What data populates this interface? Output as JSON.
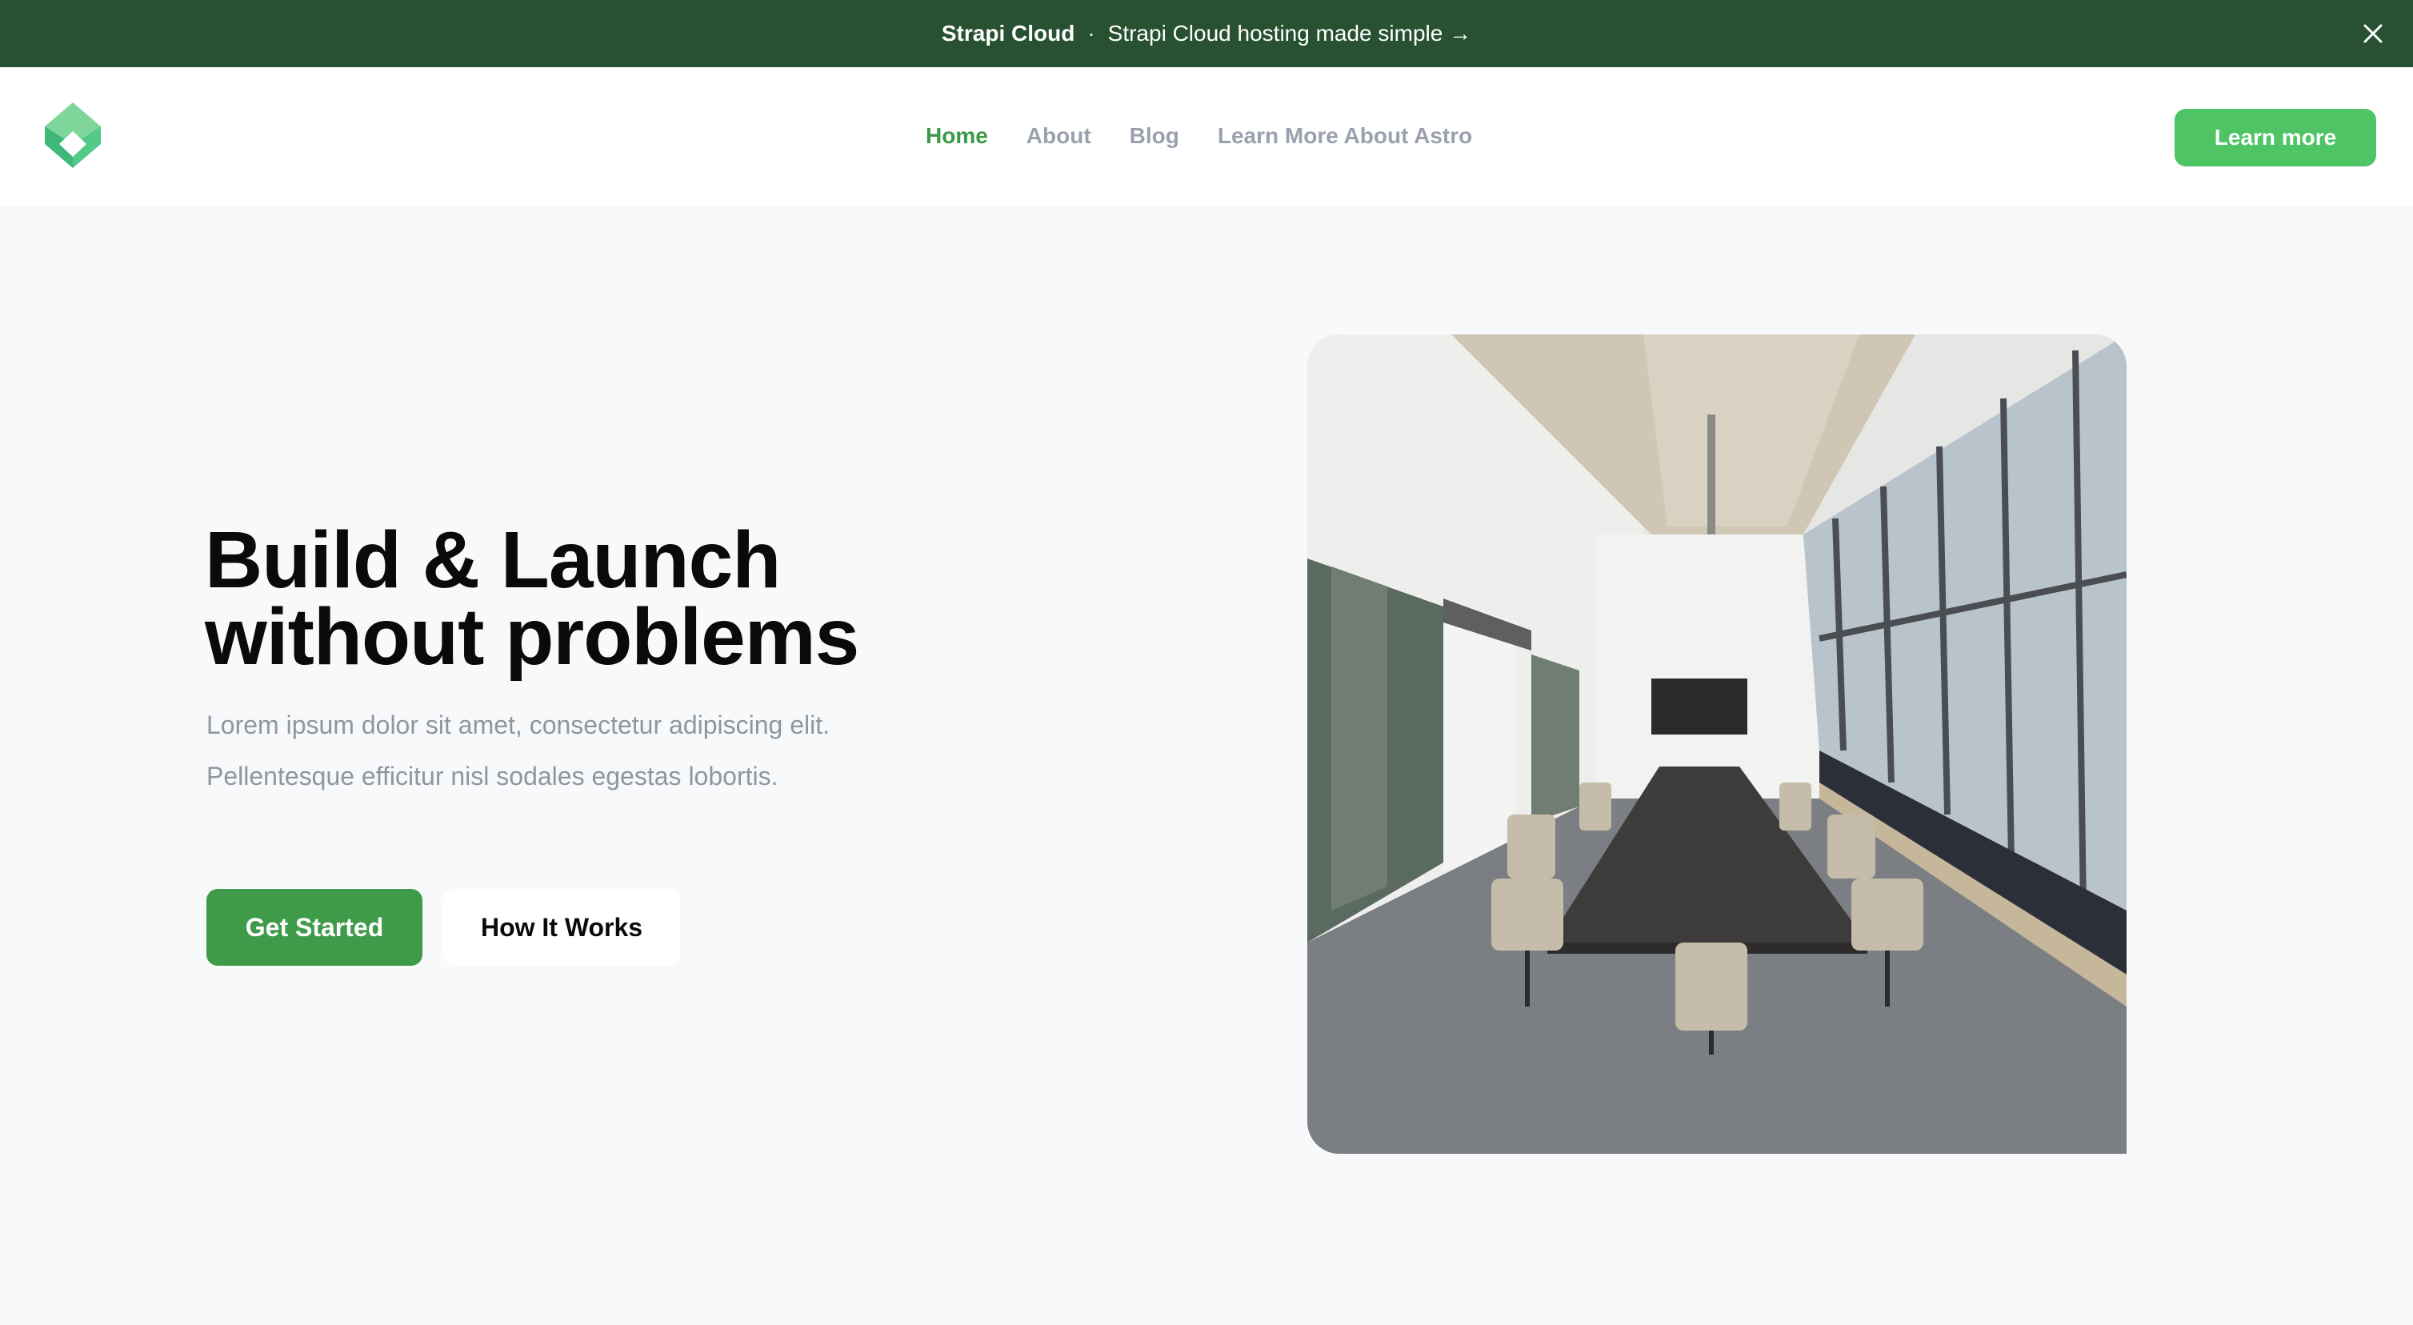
{
  "banner": {
    "brand": "Strapi Cloud",
    "separator": "·",
    "message": "Strapi Cloud hosting made simple →",
    "close_icon": "close-icon"
  },
  "header": {
    "logo_icon": "logo-icon",
    "nav": [
      {
        "label": "Home",
        "active": true
      },
      {
        "label": "About",
        "active": false
      },
      {
        "label": "Blog",
        "active": false
      },
      {
        "label": "Learn More About Astro",
        "active": false
      }
    ],
    "cta_label": "Learn more"
  },
  "hero": {
    "title_line1": "Build & Launch",
    "title_line2": "without problems",
    "description": "Lorem ipsum dolor sit amet, consectetur adipiscing elit. Pellentesque efficitur nisl sodales egestas lobortis.",
    "primary_button": "Get Started",
    "secondary_button": "How It Works",
    "image": "conference-room-photo"
  },
  "colors": {
    "banner_bg": "#275131",
    "accent": "#3f9b49",
    "cta": "#4ec465",
    "nav_active": "#3a9a47",
    "nav_inactive": "#9aa1ad"
  }
}
